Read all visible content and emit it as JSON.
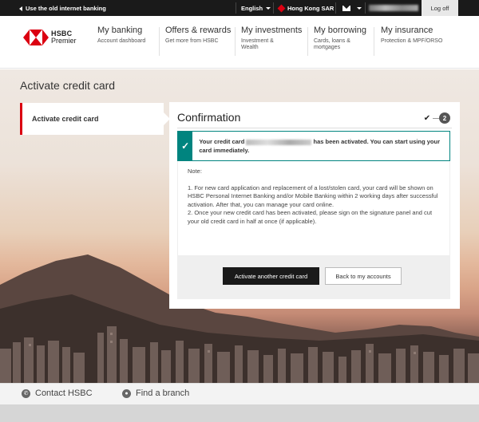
{
  "topbar": {
    "old_link": "Use the old internet banking",
    "language": "English",
    "region": "Hong Kong SAR",
    "logoff": "Log off"
  },
  "logo": {
    "brand": "HSBC",
    "tier": "Premier"
  },
  "nav": [
    {
      "title": "My banking",
      "sub": "Account dashboard"
    },
    {
      "title": "Offers & rewards",
      "sub": "Get more from HSBC"
    },
    {
      "title": "My investments",
      "sub": "Investment & Wealth"
    },
    {
      "title": "My borrowing",
      "sub": "Cards, loans & mortgages"
    },
    {
      "title": "My insurance",
      "sub": "Protection & MPF/ORSO"
    }
  ],
  "page": {
    "title": "Activate credit card",
    "sidebar_tab": "Activate credit card"
  },
  "card": {
    "title": "Confirmation",
    "step_current": "2",
    "success_prefix": "Your credit card",
    "success_suffix": "has been activated. You can start using your card immediately.",
    "note_label": "Note:",
    "note_1": "1. For new card application and replacement of a lost/stolen card, your card will be shown on HSBC Personal Internet Banking and/or Mobile Banking within 2 working days after successful activation. After that, you can manage your card online.",
    "note_2": "2. Once your new credit card has been activated, please sign on the signature panel and cut your old credit card in half at once (if applicable).",
    "btn_primary": "Activate another credit card",
    "btn_secondary": "Back to my accounts"
  },
  "footer": {
    "contact": "Contact HSBC",
    "branch": "Find a branch"
  },
  "colors": {
    "brand_red": "#db0011",
    "success_teal": "#00847f",
    "dark": "#1a1a1a"
  }
}
